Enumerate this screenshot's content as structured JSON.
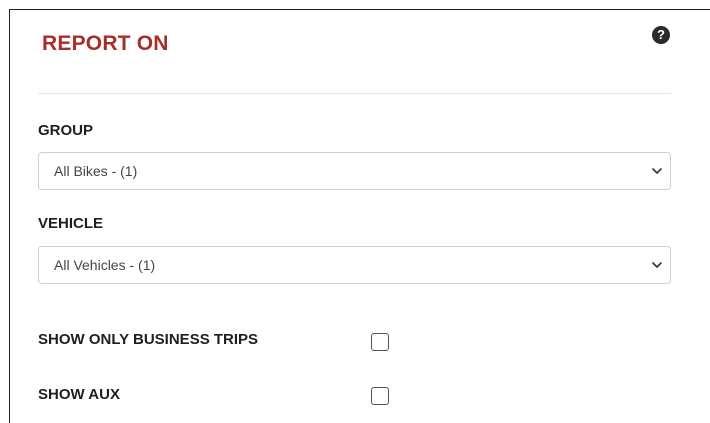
{
  "header": {
    "title": "REPORT ON",
    "help_icon_glyph": "?"
  },
  "group": {
    "label": "GROUP",
    "selected": "All Bikes - (1)"
  },
  "vehicle": {
    "label": "VEHICLE",
    "selected": "All Vehicles - (1)"
  },
  "options": {
    "business_trips_label": "SHOW ONLY BUSINESS TRIPS",
    "business_trips_checked": false,
    "aux_label": "SHOW AUX",
    "aux_checked": false
  },
  "colors": {
    "title": "#a4302a",
    "text": "#1f1f1f",
    "border": "#cfcfcf"
  },
  "icons": {
    "help": "question-circle-icon",
    "chevron": "chevron-down-icon"
  }
}
